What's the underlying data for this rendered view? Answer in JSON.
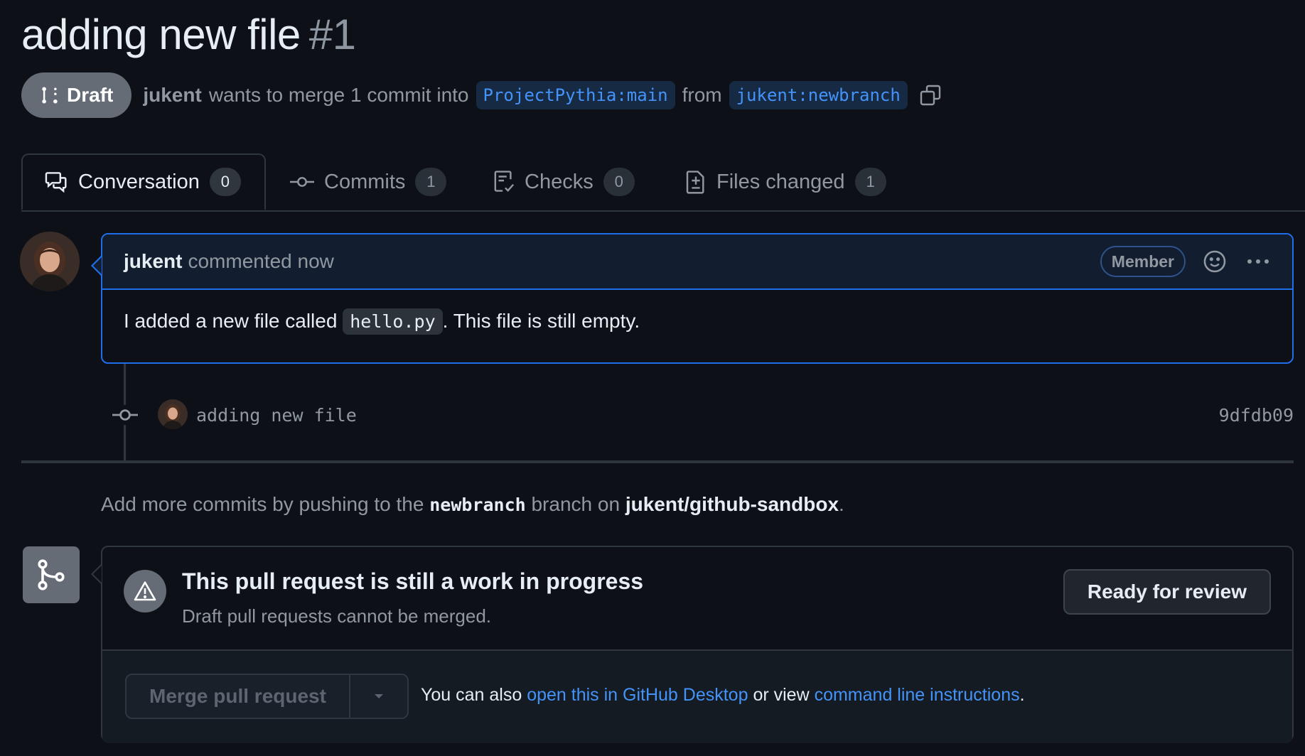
{
  "pr": {
    "title": "adding new file",
    "number": "#1",
    "status": "Draft",
    "author": "jukent",
    "merge_text": "wants to merge 1 commit into",
    "base_branch": "ProjectPythia:main",
    "from_text": "from",
    "head_branch": "jukent:newbranch"
  },
  "tabs": [
    {
      "label": "Conversation",
      "count": "0"
    },
    {
      "label": "Commits",
      "count": "1"
    },
    {
      "label": "Checks",
      "count": "0"
    },
    {
      "label": "Files changed",
      "count": "1"
    }
  ],
  "comment": {
    "author": "jukent",
    "meta": "commented now",
    "badge": "Member",
    "body_pre": "I added a new file called",
    "body_code": "hello.py",
    "body_post": ". This file is still empty."
  },
  "commit": {
    "message": "adding new file",
    "sha": "9dfdb09"
  },
  "hint": {
    "pre": "Add more commits by pushing to the",
    "branch": "newbranch",
    "mid": "branch on",
    "repo": "jukent/github-sandbox",
    "post": "."
  },
  "merge": {
    "title": "This pull request is still a work in progress",
    "subtitle": "Draft pull requests cannot be merged.",
    "ready_label": "Ready for review",
    "merge_label": "Merge pull request",
    "note_pre": "You can also",
    "note_link1": "open this in GitHub Desktop",
    "note_mid": "or view",
    "note_link2": "command line instructions",
    "note_post": "."
  },
  "colors": {
    "background": "#0d1117",
    "accent": "#1f6feb",
    "link": "#4493f8",
    "muted": "#9198a1",
    "draft_badge": "#656c76"
  }
}
